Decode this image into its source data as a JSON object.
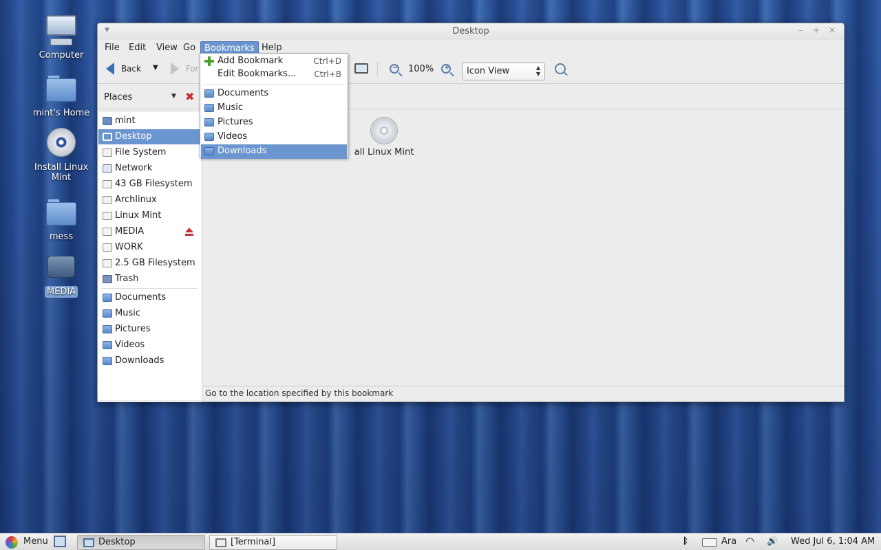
{
  "desktop": {
    "icons": [
      {
        "label": "Computer",
        "icon": "computer-icon"
      },
      {
        "label": "mint's Home",
        "icon": "home-folder-icon"
      },
      {
        "label": "Install Linux Mint",
        "icon": "cd-icon"
      },
      {
        "label": "mess",
        "icon": "folder-icon"
      },
      {
        "label": "MEDIA",
        "icon": "drive-icon"
      }
    ]
  },
  "window": {
    "title": "Desktop",
    "menu": {
      "file": "File",
      "edit": "Edit",
      "view": "View",
      "go": "Go",
      "bookmarks": "Bookmarks",
      "help": "Help"
    },
    "toolbar": {
      "back": "Back",
      "forward": "For",
      "zoom": "100%",
      "view_mode": "Icon View"
    },
    "sidebar": {
      "header": "Places",
      "items": [
        {
          "label": "mint",
          "icon": "home-icon"
        },
        {
          "label": "Desktop",
          "icon": "desktop-icon"
        },
        {
          "label": "File System",
          "icon": "drive-icon"
        },
        {
          "label": "Network",
          "icon": "network-icon"
        },
        {
          "label": "43 GB Filesystem",
          "icon": "drive-icon"
        },
        {
          "label": "Archlinux",
          "icon": "drive-icon"
        },
        {
          "label": "Linux Mint",
          "icon": "drive-icon"
        },
        {
          "label": "MEDIA",
          "icon": "drive-icon"
        },
        {
          "label": "WORK",
          "icon": "drive-icon"
        },
        {
          "label": "2.5 GB Filesystem",
          "icon": "drive-icon"
        },
        {
          "label": "Trash",
          "icon": "trash-icon"
        },
        {
          "label": "Documents",
          "icon": "folder-icon"
        },
        {
          "label": "Music",
          "icon": "folder-icon"
        },
        {
          "label": "Pictures",
          "icon": "folder-icon"
        },
        {
          "label": "Videos",
          "icon": "folder-icon"
        },
        {
          "label": "Downloads",
          "icon": "folder-icon"
        }
      ]
    },
    "content": {
      "file_label": "all Linux Mint"
    },
    "status": "Go to the location specified by this bookmark"
  },
  "bookmarks_menu": {
    "add": {
      "label": "Add Bookmark",
      "accel": "Ctrl+D"
    },
    "edit": {
      "label": "Edit Bookmarks...",
      "accel": "Ctrl+B"
    },
    "items": [
      "Documents",
      "Music",
      "Pictures",
      "Videos",
      "Downloads"
    ]
  },
  "panel": {
    "menu": "Menu",
    "tasks": [
      "Desktop",
      "[Terminal]"
    ],
    "keyboard": "Ara",
    "clock": "Wed Jul  6,  1:04 AM"
  },
  "colors": {
    "selection": "#6b95cf",
    "accent": "#3a6fb8"
  }
}
